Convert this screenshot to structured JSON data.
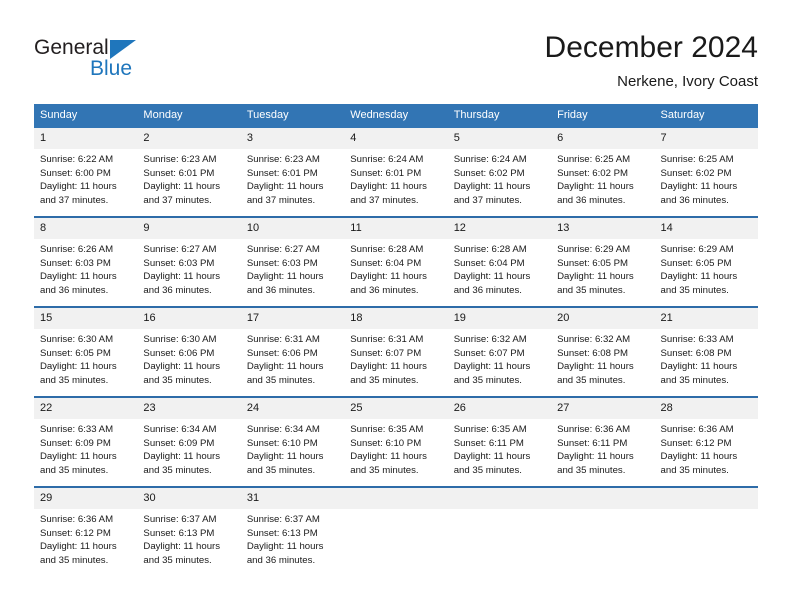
{
  "brand": {
    "name_top": "General",
    "name_bottom": "Blue",
    "triangle_color": "#1f76bc",
    "text_color": "#231f20"
  },
  "header": {
    "title": "December 2024",
    "subtitle": "Nerkene, Ivory Coast"
  },
  "theme": {
    "header_blue": "#3275b4",
    "week_border_blue": "#2e6ca8",
    "daynum_bg": "#f1f1f1",
    "text": "#1a1a1a"
  },
  "weekdays": [
    "Sunday",
    "Monday",
    "Tuesday",
    "Wednesday",
    "Thursday",
    "Friday",
    "Saturday"
  ],
  "weeks": [
    {
      "days": [
        {
          "num": "1",
          "sunrise": "Sunrise: 6:22 AM",
          "sunset": "Sunset: 6:00 PM",
          "daylight_1": "Daylight: 11 hours",
          "daylight_2": "and 37 minutes."
        },
        {
          "num": "2",
          "sunrise": "Sunrise: 6:23 AM",
          "sunset": "Sunset: 6:01 PM",
          "daylight_1": "Daylight: 11 hours",
          "daylight_2": "and 37 minutes."
        },
        {
          "num": "3",
          "sunrise": "Sunrise: 6:23 AM",
          "sunset": "Sunset: 6:01 PM",
          "daylight_1": "Daylight: 11 hours",
          "daylight_2": "and 37 minutes."
        },
        {
          "num": "4",
          "sunrise": "Sunrise: 6:24 AM",
          "sunset": "Sunset: 6:01 PM",
          "daylight_1": "Daylight: 11 hours",
          "daylight_2": "and 37 minutes."
        },
        {
          "num": "5",
          "sunrise": "Sunrise: 6:24 AM",
          "sunset": "Sunset: 6:02 PM",
          "daylight_1": "Daylight: 11 hours",
          "daylight_2": "and 37 minutes."
        },
        {
          "num": "6",
          "sunrise": "Sunrise: 6:25 AM",
          "sunset": "Sunset: 6:02 PM",
          "daylight_1": "Daylight: 11 hours",
          "daylight_2": "and 36 minutes."
        },
        {
          "num": "7",
          "sunrise": "Sunrise: 6:25 AM",
          "sunset": "Sunset: 6:02 PM",
          "daylight_1": "Daylight: 11 hours",
          "daylight_2": "and 36 minutes."
        }
      ]
    },
    {
      "days": [
        {
          "num": "8",
          "sunrise": "Sunrise: 6:26 AM",
          "sunset": "Sunset: 6:03 PM",
          "daylight_1": "Daylight: 11 hours",
          "daylight_2": "and 36 minutes."
        },
        {
          "num": "9",
          "sunrise": "Sunrise: 6:27 AM",
          "sunset": "Sunset: 6:03 PM",
          "daylight_1": "Daylight: 11 hours",
          "daylight_2": "and 36 minutes."
        },
        {
          "num": "10",
          "sunrise": "Sunrise: 6:27 AM",
          "sunset": "Sunset: 6:03 PM",
          "daylight_1": "Daylight: 11 hours",
          "daylight_2": "and 36 minutes."
        },
        {
          "num": "11",
          "sunrise": "Sunrise: 6:28 AM",
          "sunset": "Sunset: 6:04 PM",
          "daylight_1": "Daylight: 11 hours",
          "daylight_2": "and 36 minutes."
        },
        {
          "num": "12",
          "sunrise": "Sunrise: 6:28 AM",
          "sunset": "Sunset: 6:04 PM",
          "daylight_1": "Daylight: 11 hours",
          "daylight_2": "and 36 minutes."
        },
        {
          "num": "13",
          "sunrise": "Sunrise: 6:29 AM",
          "sunset": "Sunset: 6:05 PM",
          "daylight_1": "Daylight: 11 hours",
          "daylight_2": "and 35 minutes."
        },
        {
          "num": "14",
          "sunrise": "Sunrise: 6:29 AM",
          "sunset": "Sunset: 6:05 PM",
          "daylight_1": "Daylight: 11 hours",
          "daylight_2": "and 35 minutes."
        }
      ]
    },
    {
      "days": [
        {
          "num": "15",
          "sunrise": "Sunrise: 6:30 AM",
          "sunset": "Sunset: 6:05 PM",
          "daylight_1": "Daylight: 11 hours",
          "daylight_2": "and 35 minutes."
        },
        {
          "num": "16",
          "sunrise": "Sunrise: 6:30 AM",
          "sunset": "Sunset: 6:06 PM",
          "daylight_1": "Daylight: 11 hours",
          "daylight_2": "and 35 minutes."
        },
        {
          "num": "17",
          "sunrise": "Sunrise: 6:31 AM",
          "sunset": "Sunset: 6:06 PM",
          "daylight_1": "Daylight: 11 hours",
          "daylight_2": "and 35 minutes."
        },
        {
          "num": "18",
          "sunrise": "Sunrise: 6:31 AM",
          "sunset": "Sunset: 6:07 PM",
          "daylight_1": "Daylight: 11 hours",
          "daylight_2": "and 35 minutes."
        },
        {
          "num": "19",
          "sunrise": "Sunrise: 6:32 AM",
          "sunset": "Sunset: 6:07 PM",
          "daylight_1": "Daylight: 11 hours",
          "daylight_2": "and 35 minutes."
        },
        {
          "num": "20",
          "sunrise": "Sunrise: 6:32 AM",
          "sunset": "Sunset: 6:08 PM",
          "daylight_1": "Daylight: 11 hours",
          "daylight_2": "and 35 minutes."
        },
        {
          "num": "21",
          "sunrise": "Sunrise: 6:33 AM",
          "sunset": "Sunset: 6:08 PM",
          "daylight_1": "Daylight: 11 hours",
          "daylight_2": "and 35 minutes."
        }
      ]
    },
    {
      "days": [
        {
          "num": "22",
          "sunrise": "Sunrise: 6:33 AM",
          "sunset": "Sunset: 6:09 PM",
          "daylight_1": "Daylight: 11 hours",
          "daylight_2": "and 35 minutes."
        },
        {
          "num": "23",
          "sunrise": "Sunrise: 6:34 AM",
          "sunset": "Sunset: 6:09 PM",
          "daylight_1": "Daylight: 11 hours",
          "daylight_2": "and 35 minutes."
        },
        {
          "num": "24",
          "sunrise": "Sunrise: 6:34 AM",
          "sunset": "Sunset: 6:10 PM",
          "daylight_1": "Daylight: 11 hours",
          "daylight_2": "and 35 minutes."
        },
        {
          "num": "25",
          "sunrise": "Sunrise: 6:35 AM",
          "sunset": "Sunset: 6:10 PM",
          "daylight_1": "Daylight: 11 hours",
          "daylight_2": "and 35 minutes."
        },
        {
          "num": "26",
          "sunrise": "Sunrise: 6:35 AM",
          "sunset": "Sunset: 6:11 PM",
          "daylight_1": "Daylight: 11 hours",
          "daylight_2": "and 35 minutes."
        },
        {
          "num": "27",
          "sunrise": "Sunrise: 6:36 AM",
          "sunset": "Sunset: 6:11 PM",
          "daylight_1": "Daylight: 11 hours",
          "daylight_2": "and 35 minutes."
        },
        {
          "num": "28",
          "sunrise": "Sunrise: 6:36 AM",
          "sunset": "Sunset: 6:12 PM",
          "daylight_1": "Daylight: 11 hours",
          "daylight_2": "and 35 minutes."
        }
      ]
    },
    {
      "days": [
        {
          "num": "29",
          "sunrise": "Sunrise: 6:36 AM",
          "sunset": "Sunset: 6:12 PM",
          "daylight_1": "Daylight: 11 hours",
          "daylight_2": "and 35 minutes."
        },
        {
          "num": "30",
          "sunrise": "Sunrise: 6:37 AM",
          "sunset": "Sunset: 6:13 PM",
          "daylight_1": "Daylight: 11 hours",
          "daylight_2": "and 35 minutes."
        },
        {
          "num": "31",
          "sunrise": "Sunrise: 6:37 AM",
          "sunset": "Sunset: 6:13 PM",
          "daylight_1": "Daylight: 11 hours",
          "daylight_2": "and 36 minutes."
        },
        {
          "num": "",
          "sunrise": "",
          "sunset": "",
          "daylight_1": "",
          "daylight_2": ""
        },
        {
          "num": "",
          "sunrise": "",
          "sunset": "",
          "daylight_1": "",
          "daylight_2": ""
        },
        {
          "num": "",
          "sunrise": "",
          "sunset": "",
          "daylight_1": "",
          "daylight_2": ""
        },
        {
          "num": "",
          "sunrise": "",
          "sunset": "",
          "daylight_1": "",
          "daylight_2": ""
        }
      ]
    }
  ]
}
